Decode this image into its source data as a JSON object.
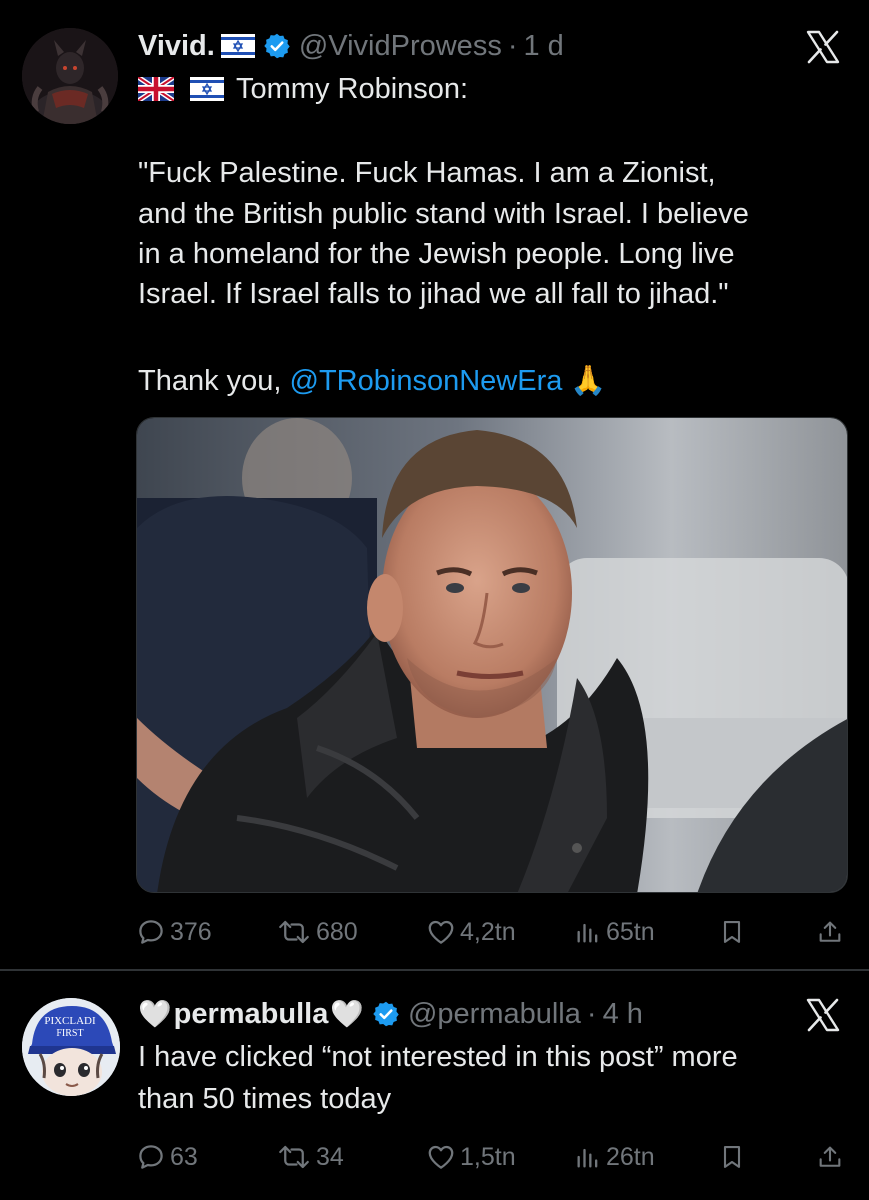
{
  "tweets": [
    {
      "display_name": "Vivid.",
      "handle": "@VividProwess",
      "separator": "·",
      "time": "1 d",
      "lines": [
        "Tommy Robinson:",
        "\"Fuck Palestine. Fuck Hamas. I am a Zionist,",
        "and the British public stand with Israel. I believe",
        "in a homeland for the Jewish people. Long live",
        "Israel. If Israel falls to jihad we all fall to jihad.\"",
        "Thank you, "
      ],
      "mention": "@TRobinsonNewEra",
      "emoji": "🙏",
      "stats": {
        "replies": "376",
        "reposts": "680",
        "likes": "4,2tn",
        "views": "65tn"
      }
    },
    {
      "display_name_prefix": "🤍",
      "display_name": "permabulla",
      "display_name_suffix": "🤍",
      "handle": "@permabulla",
      "separator": "·",
      "time": "4 h",
      "lines": [
        "I have clicked “not interested in this post” more",
        "than 50 times today"
      ],
      "avatar_cap_text_1": "PIXCLADI",
      "avatar_cap_text_2": "FIRST",
      "stats": {
        "replies": "63",
        "reposts": "34",
        "likes": "1,5tn",
        "views": "26tn"
      }
    }
  ],
  "icons": {
    "verified": "verified-badge-icon",
    "x_logo": "x-logo-icon",
    "reply": "reply-icon",
    "repost": "repost-icon",
    "like": "heart-icon",
    "views": "views-icon",
    "bookmark": "bookmark-icon",
    "share": "share-icon"
  },
  "colors": {
    "background": "#000000",
    "text": "#e7e9ea",
    "muted": "#71767b",
    "link": "#1d9bf0",
    "verified": "#1d9bf0"
  }
}
